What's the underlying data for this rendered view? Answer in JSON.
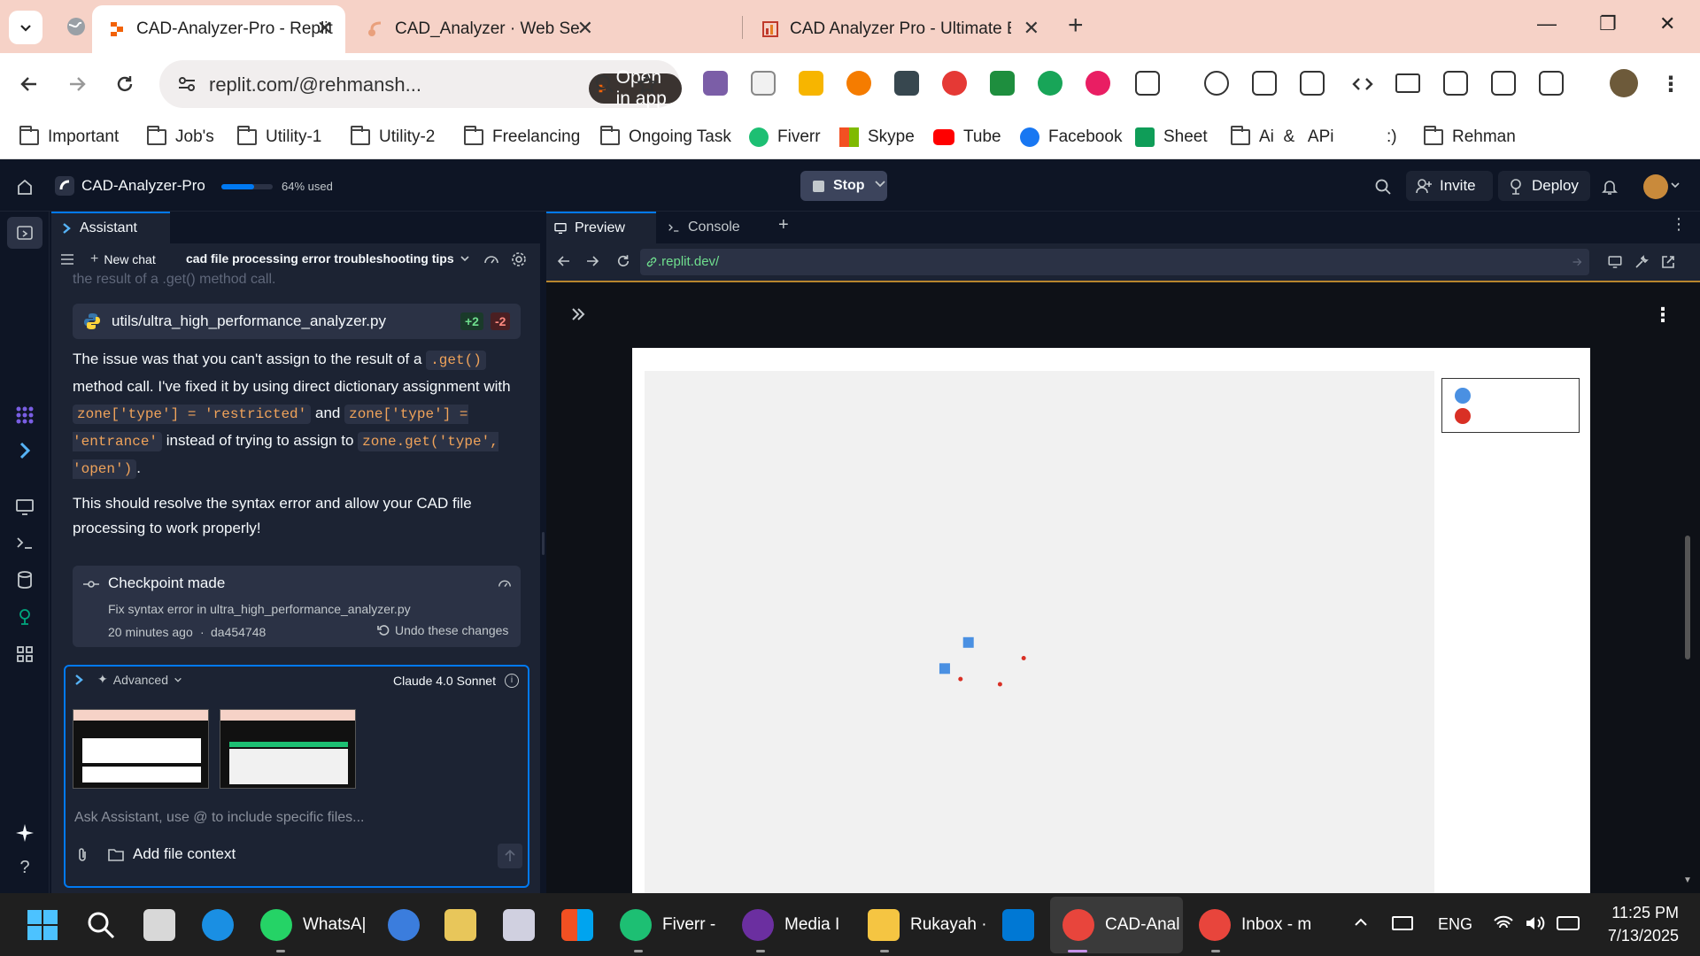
{
  "browser": {
    "tabs": [
      {
        "title": "CAD-Analyzer-Pro - Replit",
        "active": true
      },
      {
        "title": "CAD_Analyzer · Web Service · R",
        "active": false
      },
      {
        "title": "CAD Analyzer Pro - Ultimate Ed",
        "active": false
      }
    ],
    "url": "replit.com/@rehmansh...",
    "open_in_app": "Open in app",
    "bookmarks": [
      "Important",
      "Job's",
      "Utility-1",
      "Utility-2",
      "Freelancing",
      "Ongoing Task",
      "Fiverr",
      "Skype",
      "Tube",
      "Facebook",
      "Sheet",
      "Ai  &   APi",
      ":)",
      "Rehman"
    ]
  },
  "workspace": {
    "project_name": "CAD-Analyzer-Pro",
    "usage_percent": 64,
    "usage_label": "64% used",
    "stop_label": "Stop",
    "invite_label": "Invite",
    "deploy_label": "Deploy"
  },
  "assistant": {
    "tab_label": "Assistant",
    "new_chat": "New chat",
    "chat_title": "cad file processing error troubleshooting tips",
    "faded_text": "the result of a .get() method call.",
    "file_card": {
      "name": "utils/ultra_high_performance_analyzer.py",
      "added": "+2",
      "removed": "-2"
    },
    "msg1_a": "The issue was that you can't assign to the result of a",
    "msg1_code1": ".get()",
    "msg1_b": "method call. I've fixed it by using direct dictionary assignment with",
    "msg1_code2": "zone['type'] = 'restricted'",
    "msg1_c": "and",
    "msg1_code3": "zone['type'] = 'entrance'",
    "msg1_d": "instead of trying to assign to",
    "msg1_code4": "zone.get('type', 'open')",
    "msg1_e": ".",
    "msg2": "This should resolve the syntax error and allow your CAD file processing to work properly!",
    "checkpoint": {
      "title": "Checkpoint made",
      "description": "Fix syntax error in ultra_high_performance_analyzer.py",
      "time": "20 minutes ago",
      "commit": "da454748",
      "undo": "Undo these changes"
    },
    "composer": {
      "mode": "Advanced",
      "model": "Claude 4.0 Sonnet",
      "placeholder": "Ask Assistant, use @ to include specific files...",
      "add_context": "Add file context"
    }
  },
  "preview": {
    "tab_preview": "Preview",
    "tab_console": "Console",
    "url": ".replit.dev/"
  },
  "chart_data": {
    "type": "scatter",
    "series": [
      {
        "color": "#4a90e2",
        "points": [
          [
            0.41,
            0.52
          ],
          [
            0.38,
            0.57
          ]
        ]
      },
      {
        "color": "#d93025",
        "points": [
          [
            0.48,
            0.55
          ],
          [
            0.45,
            0.6
          ],
          [
            0.4,
            0.59
          ]
        ]
      }
    ],
    "legend_placement": "top-right"
  },
  "taskbar": {
    "items": [
      {
        "label": "WhatsA|"
      },
      {
        "label": "Fiverr -"
      },
      {
        "label": "Media I"
      },
      {
        "label": "Rukayah ·"
      },
      {
        "label": "CAD-Anal"
      },
      {
        "label": "Inbox - m"
      }
    ],
    "language": "ENG",
    "time": "11:25 PM",
    "date": "7/13/2025"
  }
}
